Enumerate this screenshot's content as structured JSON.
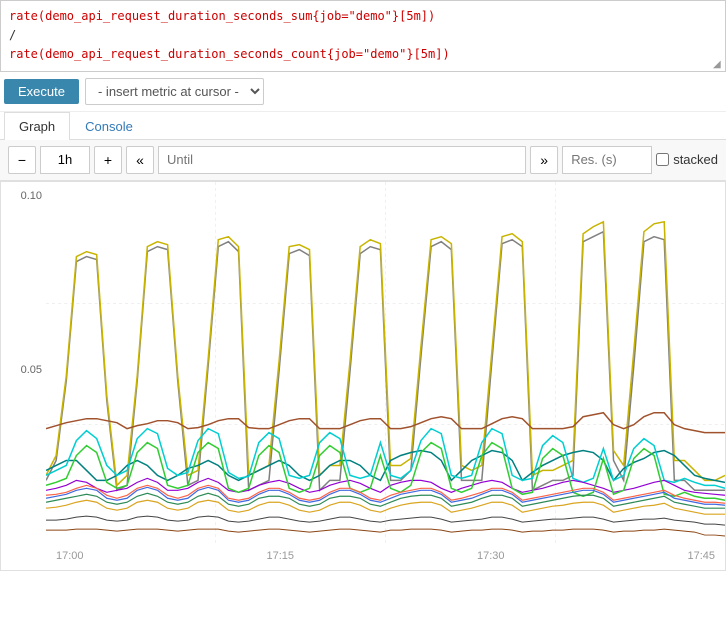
{
  "query": {
    "line1": "rate(demo_api_request_duration_seconds_sum{job=\"demo\"}[5m])",
    "divider": "/",
    "line2": "rate(demo_api_request_duration_seconds_count{job=\"demo\"}[5m])"
  },
  "toolbar": {
    "execute_label": "Execute",
    "insert_metric_placeholder": "- insert metric at cursor -"
  },
  "tabs": [
    {
      "label": "Graph",
      "active": true
    },
    {
      "label": "Console",
      "active": false
    }
  ],
  "graph_controls": {
    "minus_label": "−",
    "time_value": "1h",
    "plus_label": "+",
    "back_label": "«",
    "until_placeholder": "Until",
    "forward_label": "»",
    "res_placeholder": "Res. (s)",
    "stacked_label": "stacked"
  },
  "y_axis": {
    "labels": [
      "0.10",
      "0.05"
    ]
  },
  "x_axis": {
    "labels": [
      "17:00",
      "17:15",
      "17:30",
      "17:45"
    ]
  },
  "chart": {
    "accent": "#3a87ad",
    "colors": [
      "#808080",
      "#c8b400",
      "#a0522d",
      "#008080",
      "#00ced1",
      "#9400d3",
      "#32cd32",
      "#ff6347",
      "#4169e1",
      "#2e8b57",
      "#daa520",
      "#696969",
      "#ff1493"
    ]
  }
}
